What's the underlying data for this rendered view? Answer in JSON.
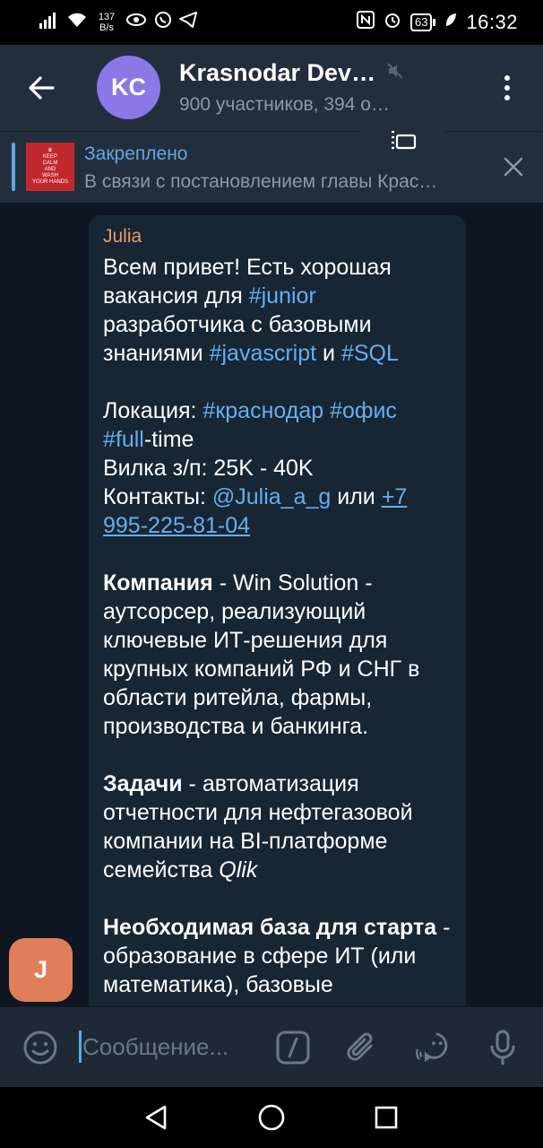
{
  "status_bar": {
    "net_speed_value": "137",
    "net_speed_unit": "B/s",
    "battery": "63",
    "time": "16:32"
  },
  "header": {
    "avatar_initials": "KC",
    "title": "Krasnodar Dev…",
    "subtitle": "900 участников, 394 о…",
    "avatar_color": "#8b78e6"
  },
  "pinned": {
    "label": "Закреплено",
    "text": "В связи с постановлением главы Крас…",
    "thumb_lines": [
      "KEEP",
      "CALM",
      "AND",
      "WASH",
      "YOUR HANDS"
    ]
  },
  "message": {
    "sender": "Julia",
    "sender_avatar": "J",
    "p1": {
      "a": "Всем привет! Есть хорошая вакансия для ",
      "tag1": "#junior",
      "b": " разработчика с базовыми знаниями ",
      "tag2": "#javascript",
      "c": " и ",
      "tag3": "#SQL"
    },
    "location_label": "Локация:  ",
    "location_tag1": "#краснодар",
    "location_tag2": "#офис",
    "full_tag": "#full",
    "full_rest": "-time",
    "salary": "Вилка з/п:  25K - 40K",
    "contacts_label": "Контакты: ",
    "contacts_user": "@Julia_a_g",
    "contacts_or": " или ",
    "contacts_phone": "+7 995-225-81-04",
    "company_label": "Компания",
    "company_text": " - Win Solution - аутсорсер, реализующий ключевые ИТ-решения для крупных компаний РФ и СНГ в области ритейла, фармы, производства и банкинга.",
    "tasks_label": "Задачи",
    "tasks_text": " - автоматизация отчетности для нефтегазовой компании на BI-платформе семейства ",
    "tasks_italic": "Qlik",
    "base_label": "Необходимая база для старта",
    "base_text": " - образование в сфере ИТ (или математика), базовые"
  },
  "input": {
    "placeholder": "Сообщение..."
  },
  "colors": {
    "app_bar": "#232e3c",
    "chat_bg": "#0e1621",
    "bubble": "#182533",
    "link": "#62b0f0",
    "sender": "#e89b6d"
  }
}
